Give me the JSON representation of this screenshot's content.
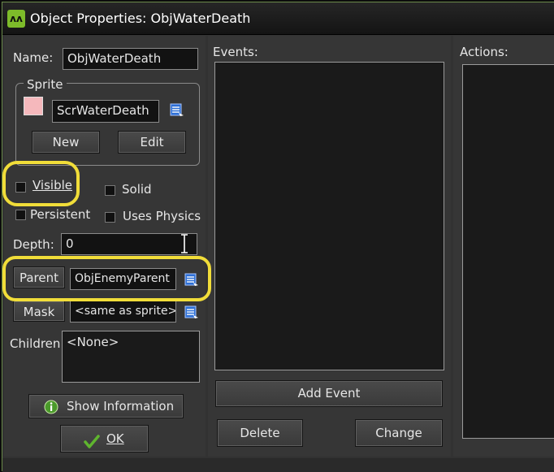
{
  "window": {
    "title": "Object Properties: ObjWaterDeath"
  },
  "properties": {
    "name_label": "Name:",
    "name_value": "ObjWaterDeath",
    "sprite_group_label": "Sprite",
    "sprite_value": "ScrWaterDeath",
    "sprite_new_label": "New",
    "sprite_edit_label": "Edit",
    "visible_label": "Visible",
    "solid_label": "Solid",
    "persistent_label": "Persistent",
    "physics_label": "Uses Physics",
    "depth_label": "Depth:",
    "depth_value": "0",
    "parent_label": "Parent",
    "parent_value": "ObjEnemyParent",
    "mask_label": "Mask",
    "mask_value": "<same as sprite>",
    "children_label": "Children:",
    "children_value": "<None>",
    "show_info_label": "Show Information",
    "ok_label": "OK"
  },
  "events": {
    "label": "Events:",
    "add_label": "Add Event",
    "delete_label": "Delete",
    "change_label": "Change"
  },
  "actions": {
    "label": "Actions:"
  },
  "colors": {
    "sprite_swatch": "#f5b8bc",
    "highlight": "#f1dd39",
    "accent_green": "#7dbb2a"
  }
}
